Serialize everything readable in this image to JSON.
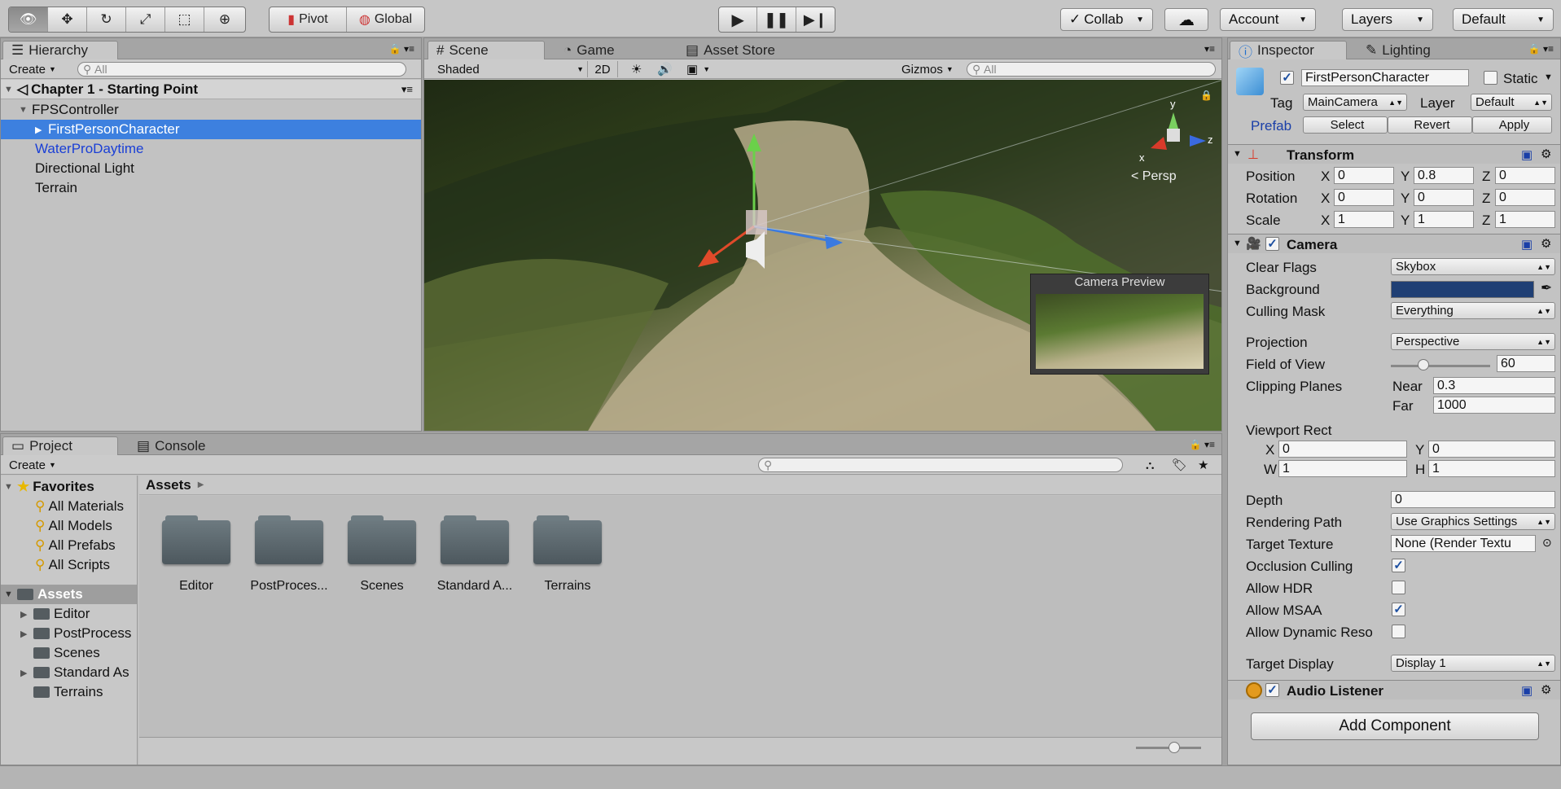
{
  "toolbar": {
    "pivot": "Pivot",
    "global": "Global",
    "collab": "Collab",
    "account": "Account",
    "layers": "Layers",
    "layout": "Default"
  },
  "hierarchy": {
    "tab": "Hierarchy",
    "create": "Create",
    "search_placeholder": "All",
    "scene": "Chapter 1 - Starting Point",
    "items": [
      {
        "label": "FPSController"
      },
      {
        "label": "FirstPersonCharacter"
      },
      {
        "label": "WaterProDaytime"
      },
      {
        "label": "Directional Light"
      },
      {
        "label": "Terrain"
      }
    ]
  },
  "scene_view": {
    "tabs": [
      "Scene",
      "Game",
      "Asset Store"
    ],
    "shading": "Shaded",
    "mode2d": "2D",
    "gizmos": "Gizmos",
    "search_placeholder": "All",
    "persp": "Persp",
    "camera_preview": "Camera Preview",
    "axis_y": "y",
    "axis_x": "x",
    "axis_z": "z"
  },
  "project": {
    "tabs": [
      "Project",
      "Console"
    ],
    "create": "Create",
    "favorites_label": "Favorites",
    "favorites": [
      "All Materials",
      "All Models",
      "All Prefabs",
      "All Scripts"
    ],
    "assets_label": "Assets",
    "tree": [
      "Editor",
      "PostProcess",
      "Scenes",
      "Standard As",
      "Terrains"
    ],
    "breadcrumb": "Assets",
    "folders": [
      "Editor",
      "PostProces...",
      "Scenes",
      "Standard A...",
      "Terrains"
    ]
  },
  "inspector": {
    "tabs": [
      "Inspector",
      "Lighting"
    ],
    "object_name": "FirstPersonCharacter",
    "static_label": "Static",
    "tag_label": "Tag",
    "tag_value": "MainCamera",
    "layer_label": "Layer",
    "layer_value": "Default",
    "prefab_label": "Prefab",
    "prefab_select": "Select",
    "prefab_revert": "Revert",
    "prefab_apply": "Apply",
    "transform": {
      "title": "Transform",
      "position_label": "Position",
      "rotation_label": "Rotation",
      "scale_label": "Scale",
      "x": "X",
      "y": "Y",
      "z": "Z",
      "position": [
        "0",
        "0.8",
        "0"
      ],
      "rotation": [
        "0",
        "0",
        "0"
      ],
      "scale": [
        "1",
        "1",
        "1"
      ]
    },
    "camera": {
      "title": "Camera",
      "clear_flags_label": "Clear Flags",
      "clear_flags": "Skybox",
      "background_label": "Background",
      "background_color": "#1f3f74",
      "culling_mask_label": "Culling Mask",
      "culling_mask": "Everything",
      "projection_label": "Projection",
      "projection": "Perspective",
      "fov_label": "Field of View",
      "fov": "60",
      "clipping_label": "Clipping Planes",
      "near_label": "Near",
      "near": "0.3",
      "far_label": "Far",
      "far": "1000",
      "viewport_label": "Viewport Rect",
      "vx_label": "X",
      "vx": "0",
      "vy_label": "Y",
      "vy": "0",
      "vw_label": "W",
      "vw": "1",
      "vh_label": "H",
      "vh": "1",
      "depth_label": "Depth",
      "depth": "0",
      "rendering_path_label": "Rendering Path",
      "rendering_path": "Use Graphics Settings",
      "target_texture_label": "Target Texture",
      "target_texture": "None (Render Textu",
      "occlusion_label": "Occlusion Culling",
      "occlusion": true,
      "hdr_label": "Allow HDR",
      "hdr": false,
      "msaa_label": "Allow MSAA",
      "msaa": true,
      "dynres_label": "Allow Dynamic Reso",
      "dynres": false,
      "target_display_label": "Target Display",
      "target_display": "Display 1"
    },
    "audio_listener": "Audio Listener",
    "add_component": "Add Component"
  }
}
